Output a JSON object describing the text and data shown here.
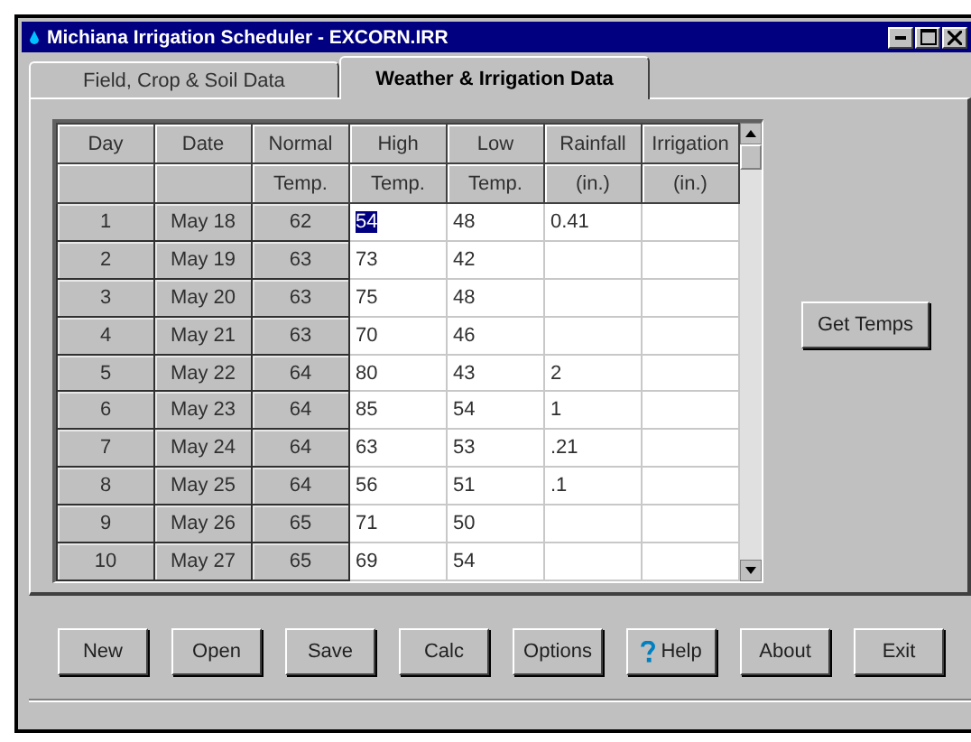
{
  "window": {
    "title": "Michiana Irrigation Scheduler - EXCORN.IRR"
  },
  "tabs": [
    {
      "label": "Field, Crop & Soil Data",
      "selected": false
    },
    {
      "label": "Weather & Irrigation Data",
      "selected": true
    }
  ],
  "table": {
    "columns": [
      {
        "line1": "Day",
        "read_only": true
      },
      {
        "line1": "Date",
        "read_only": true
      },
      {
        "line1": "Normal",
        "line2": "Temp.",
        "read_only": true
      },
      {
        "line1": "High",
        "line2": "Temp.",
        "read_only": false
      },
      {
        "line1": "Low",
        "line2": "Temp.",
        "read_only": false
      },
      {
        "line1": "Rainfall",
        "line2": "(in.)",
        "read_only": false
      },
      {
        "line1": "Irrigation",
        "line2": "(in.)",
        "read_only": false
      }
    ],
    "rows": [
      {
        "cells": [
          "1",
          "May 18",
          "62",
          "54",
          "48",
          "0.41",
          ""
        ],
        "high_selected": true
      },
      {
        "cells": [
          "2",
          "May 19",
          "63",
          "73",
          "42",
          "",
          ""
        ],
        "high_selected": false
      },
      {
        "cells": [
          "3",
          "May 20",
          "63",
          "75",
          "48",
          "",
          ""
        ],
        "high_selected": false
      },
      {
        "cells": [
          "4",
          "May 21",
          "63",
          "70",
          "46",
          "",
          ""
        ],
        "high_selected": false
      },
      {
        "cells": [
          "5",
          "May 22",
          "64",
          "80",
          "43",
          "2",
          ""
        ],
        "high_selected": false
      },
      {
        "cells": [
          "6",
          "May 23",
          "64",
          "85",
          "54",
          "1",
          ""
        ],
        "high_selected": false
      },
      {
        "cells": [
          "7",
          "May 24",
          "64",
          "63",
          "53",
          ".21",
          ""
        ],
        "high_selected": false
      },
      {
        "cells": [
          "8",
          "May 25",
          "64",
          "56",
          "51",
          ".1",
          ""
        ],
        "high_selected": false
      },
      {
        "cells": [
          "9",
          "May 26",
          "65",
          "71",
          "50",
          "",
          ""
        ],
        "high_selected": false
      },
      {
        "cells": [
          "10",
          "May 27",
          "65",
          "69",
          "54",
          "",
          ""
        ],
        "high_selected": false
      }
    ]
  },
  "get_temps_button": "Get Temps",
  "buttons": [
    {
      "label": "New",
      "kind": "plain"
    },
    {
      "label": "Open",
      "kind": "plain"
    },
    {
      "label": "Save",
      "kind": "plain"
    },
    {
      "label": "Calc",
      "kind": "plain"
    },
    {
      "label": "Options",
      "kind": "plain"
    },
    {
      "label": "Help",
      "kind": "help"
    },
    {
      "label": "About",
      "kind": "plain"
    },
    {
      "label": "Exit",
      "kind": "plain"
    }
  ]
}
